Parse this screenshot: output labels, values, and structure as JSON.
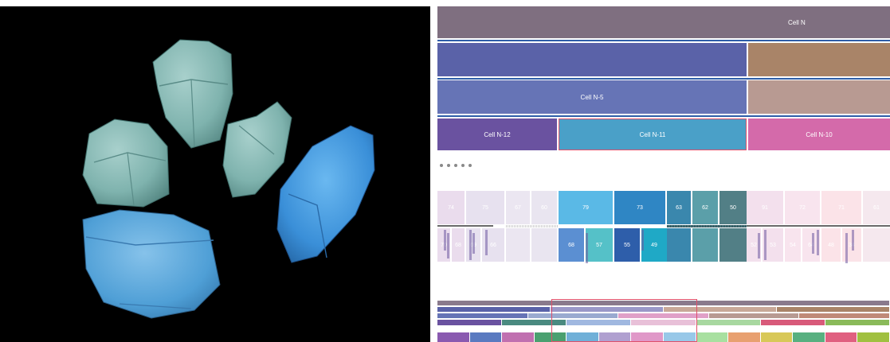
{
  "viewer": {
    "background": "#000000",
    "colors": {
      "teal": "#7fb3ae",
      "blue": "#4f9fd6",
      "brightblue": "#3a8fd8"
    }
  },
  "lineage": {
    "rows": [
      [
        {
          "label": "Cell N",
          "color": "#7f6f80"
        }
      ],
      [
        {
          "label": "",
          "color": "#5a62a8"
        },
        {
          "label": "",
          "color": "#a98468"
        }
      ],
      [
        {
          "label": "Cell N-5",
          "color": "#6674b6"
        },
        {
          "label": "",
          "color": "#b89a92"
        }
      ],
      [
        {
          "label": "Cell N-12",
          "color": "#6a52a0"
        },
        {
          "label": "Cell N-11",
          "color": "#4aa0c8",
          "selected": true
        },
        {
          "label": "Cell N-10",
          "color": "#d46aaa"
        }
      ]
    ],
    "selection_color": "#e0506a",
    "ellipsis_count": 5
  },
  "top_cells": [
    {
      "label": "74",
      "color": "#eadced"
    },
    {
      "label": "75",
      "color": "#e7e1ef"
    },
    {
      "label": "67",
      "color": "#ebe6f1"
    },
    {
      "label": "60",
      "color": "#e9e5f0"
    },
    {
      "label": "79",
      "color": "#5ab9e6"
    },
    {
      "label": "73",
      "color": "#2f86c4"
    },
    {
      "label": "63",
      "color": "#3a87ad"
    },
    {
      "label": "62",
      "color": "#5b9fa9"
    },
    {
      "label": "50",
      "color": "#527f86"
    },
    {
      "label": "91",
      "color": "#f3e0ed"
    },
    {
      "label": "72",
      "color": "#f8e4ee"
    },
    {
      "label": "71",
      "color": "#fbe3e8"
    },
    {
      "label": "61",
      "color": "#f5e8ee"
    }
  ],
  "bottom_cells": [
    {
      "label": "70",
      "color": "#eadced"
    },
    {
      "label": "68",
      "color": "#eadced"
    },
    {
      "label": "69",
      "color": "#e7e1ef"
    },
    {
      "label": "66",
      "color": "#e7e1ef"
    },
    {
      "label": "",
      "color": "#ebe6f1"
    },
    {
      "label": "",
      "color": "#e9e5f0"
    },
    {
      "label": "68",
      "color": "#5b8fd2"
    },
    {
      "label": "57",
      "color": "#55c1c8"
    },
    {
      "label": "55",
      "color": "#2e5eaa"
    },
    {
      "label": "49",
      "color": "#1fa9c6"
    },
    {
      "label": "",
      "color": "#3a87ad"
    },
    {
      "label": "",
      "color": "#5b9fa9"
    },
    {
      "label": "",
      "color": "#527f86"
    },
    {
      "label": "52",
      "color": "#f3e0ed"
    },
    {
      "label": "53",
      "color": "#f3e0ed"
    },
    {
      "label": "54",
      "color": "#f8e4ee"
    },
    {
      "label": "64",
      "color": "#f8e4ee"
    },
    {
      "label": "48",
      "color": "#fbe3e8"
    },
    {
      "label": "34",
      "color": "#fbe3e8"
    },
    {
      "label": "",
      "color": "#f5e8ee"
    }
  ],
  "overview": {
    "bands": [
      [
        "#8a7a8c"
      ],
      [
        "#5a62a8",
        "#9a98c8",
        "#c8a898",
        "#a98468"
      ],
      [
        "#6674b6",
        "#9aaad0",
        "#e0a0c8",
        "#b89a92",
        "#c08a78"
      ],
      [
        "#6a52a0",
        "#4a8a80",
        "#a0b8e0",
        "#e8c0d8",
        "#a8d8a0",
        "#d85a7a",
        "#8aba5a"
      ],
      [
        "#8a5ab0",
        "#5a7ac0",
        "#c070b0",
        "#4aa070",
        "#70b0d8",
        "#b0a0d0",
        "#e098c8",
        "#98c8e8",
        "#a8e0a0",
        "#e8a070",
        "#d8c858",
        "#58b080",
        "#e06080",
        "#a0c040"
      ]
    ]
  }
}
